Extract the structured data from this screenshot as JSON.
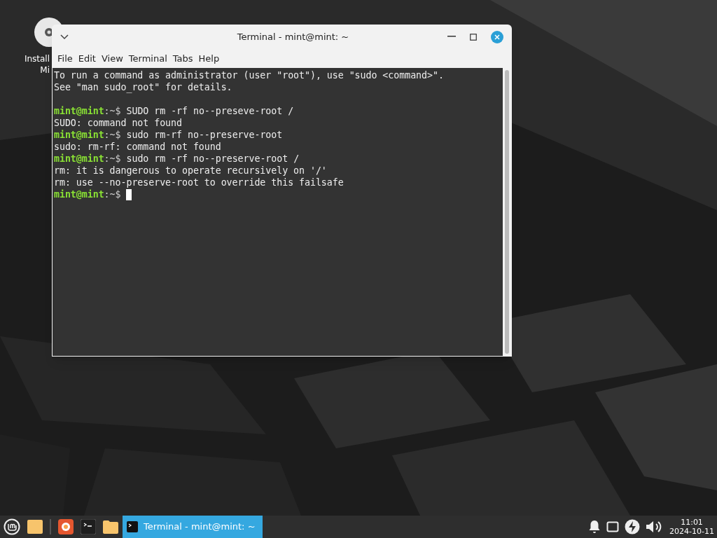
{
  "desktop": {
    "icons": [
      {
        "label_lines": [
          "Install",
          "Mi"
        ]
      }
    ]
  },
  "window": {
    "title": "Terminal - mint@mint: ~",
    "menu": [
      {
        "label": "File"
      },
      {
        "label": "Edit"
      },
      {
        "label": "View"
      },
      {
        "label": "Terminal"
      },
      {
        "label": "Tabs"
      },
      {
        "label": "Help"
      }
    ],
    "terminal": {
      "lines": [
        {
          "kind": "output",
          "text": "To run a command as administrator (user \"root\"), use \"sudo <command>\"."
        },
        {
          "kind": "output",
          "text": "See \"man sudo_root\" for details."
        },
        {
          "kind": "blank"
        },
        {
          "kind": "prompt",
          "user": "mint@mint",
          "path": ":~$",
          "command": "SUDO rm -rf no--preseve-root /",
          "cursor": false
        },
        {
          "kind": "output",
          "text": "SUDO: command not found"
        },
        {
          "kind": "prompt",
          "user": "mint@mint",
          "path": ":~$",
          "command": "sudo rm-rf no--preserve-root",
          "cursor": false
        },
        {
          "kind": "output",
          "text": "sudo: rm-rf: command not found"
        },
        {
          "kind": "prompt",
          "user": "mint@mint",
          "path": ":~$",
          "command": "sudo rm -rf no--preserve-root /",
          "cursor": false
        },
        {
          "kind": "output",
          "text": "rm: it is dangerous to operate recursively on '/'"
        },
        {
          "kind": "output",
          "text": "rm: use --no-preserve-root to override this failsafe"
        },
        {
          "kind": "prompt",
          "user": "mint@mint",
          "path": ":~$",
          "cursor": true
        }
      ]
    }
  },
  "taskbar": {
    "launchers": [
      {
        "kind": "menu"
      },
      {
        "kind": "folder"
      },
      {
        "kind": "separator"
      },
      {
        "kind": "browser"
      },
      {
        "kind": "terminal"
      },
      {
        "kind": "files"
      }
    ],
    "tasks": [
      {
        "label": "Terminal - mint@mint: ~",
        "selected": true
      }
    ],
    "tray": {
      "time": "11:01",
      "date": "2024-10-11"
    }
  }
}
